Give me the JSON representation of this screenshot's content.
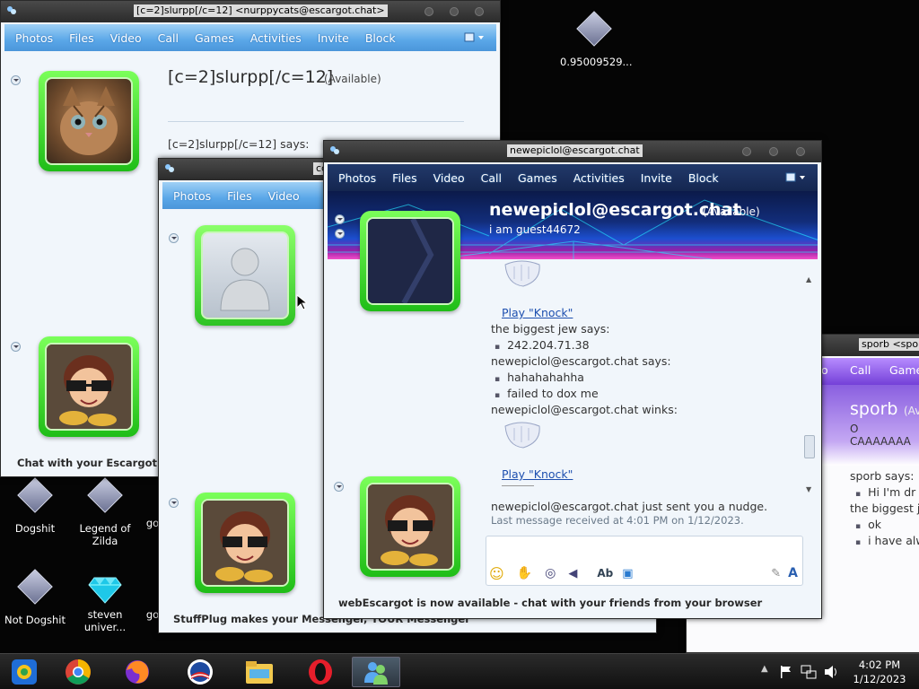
{
  "desktop": {
    "icons": [
      {
        "label": "0.95009529..."
      },
      {
        "label": "Dogshit"
      },
      {
        "label": "Legend of Zilda"
      },
      {
        "label": "go"
      },
      {
        "label": "Not Dogshit"
      },
      {
        "label": "steven univer..."
      },
      {
        "label": "go"
      }
    ]
  },
  "win_a": {
    "title": "[c=2]slurpp[/c=12] <nurppycats@escargot.chat>",
    "menu": [
      "Photos",
      "Files",
      "Video",
      "Call",
      "Games",
      "Activities",
      "Invite",
      "Block"
    ],
    "contact_name": "[c=2]slurpp[/c=12]",
    "contact_status": "(Available)",
    "says": "[c=2]slurpp[/c=12] says:",
    "ad": "Chat with your Escargot co"
  },
  "win_b": {
    "title": "cc",
    "menu": [
      "Photos",
      "Files",
      "Video"
    ],
    "ad": "StuffPlug makes your Messenger, YOUR Messenger"
  },
  "win_c": {
    "title": "newepiclol@escargot.chat",
    "menu": [
      "Photos",
      "Files",
      "Video",
      "Call",
      "Games",
      "Activities",
      "Invite",
      "Block"
    ],
    "contact_name": "newepiclol@escargot.chat",
    "contact_status": "(Available)",
    "personal_message": "i am guest44672",
    "chat": {
      "play1": "Play \"Knock\"",
      "line1": "the biggest jew says:",
      "msg1": "242.204.71.38",
      "line2": "newepiclol@escargot.chat says:",
      "msg2": "hahahahahha",
      "msg3": "failed to dox me",
      "line3": "newepiclol@escargot.chat winks:",
      "play2": "Play \"Knock\"",
      "nudge": "newepiclol@escargot.chat just sent you a nudge.",
      "last": "Last message received at 4:01 PM on 1/12/2023."
    },
    "ad": "webEscargot is now available - chat with your friends from your browser"
  },
  "win_d": {
    "title": "sporb <spor",
    "menu": [
      "o",
      "Call",
      "Games"
    ],
    "contact_name": "sporb",
    "contact_status": "(Av",
    "personal_message": "O CAAAAAAA",
    "chat": {
      "line1": "sporb says:",
      "msg1": "Hi I'm dr",
      "line2": "the biggest j",
      "msg2": "ok",
      "msg3": "i have alw"
    }
  },
  "taskbar": {
    "time": "4:02 PM",
    "date": "1/12/2023"
  },
  "colors": {
    "menubar": "#5aa7e8",
    "avatar_frame": "#3ad42a",
    "taskbar": "#1a1a1a"
  }
}
